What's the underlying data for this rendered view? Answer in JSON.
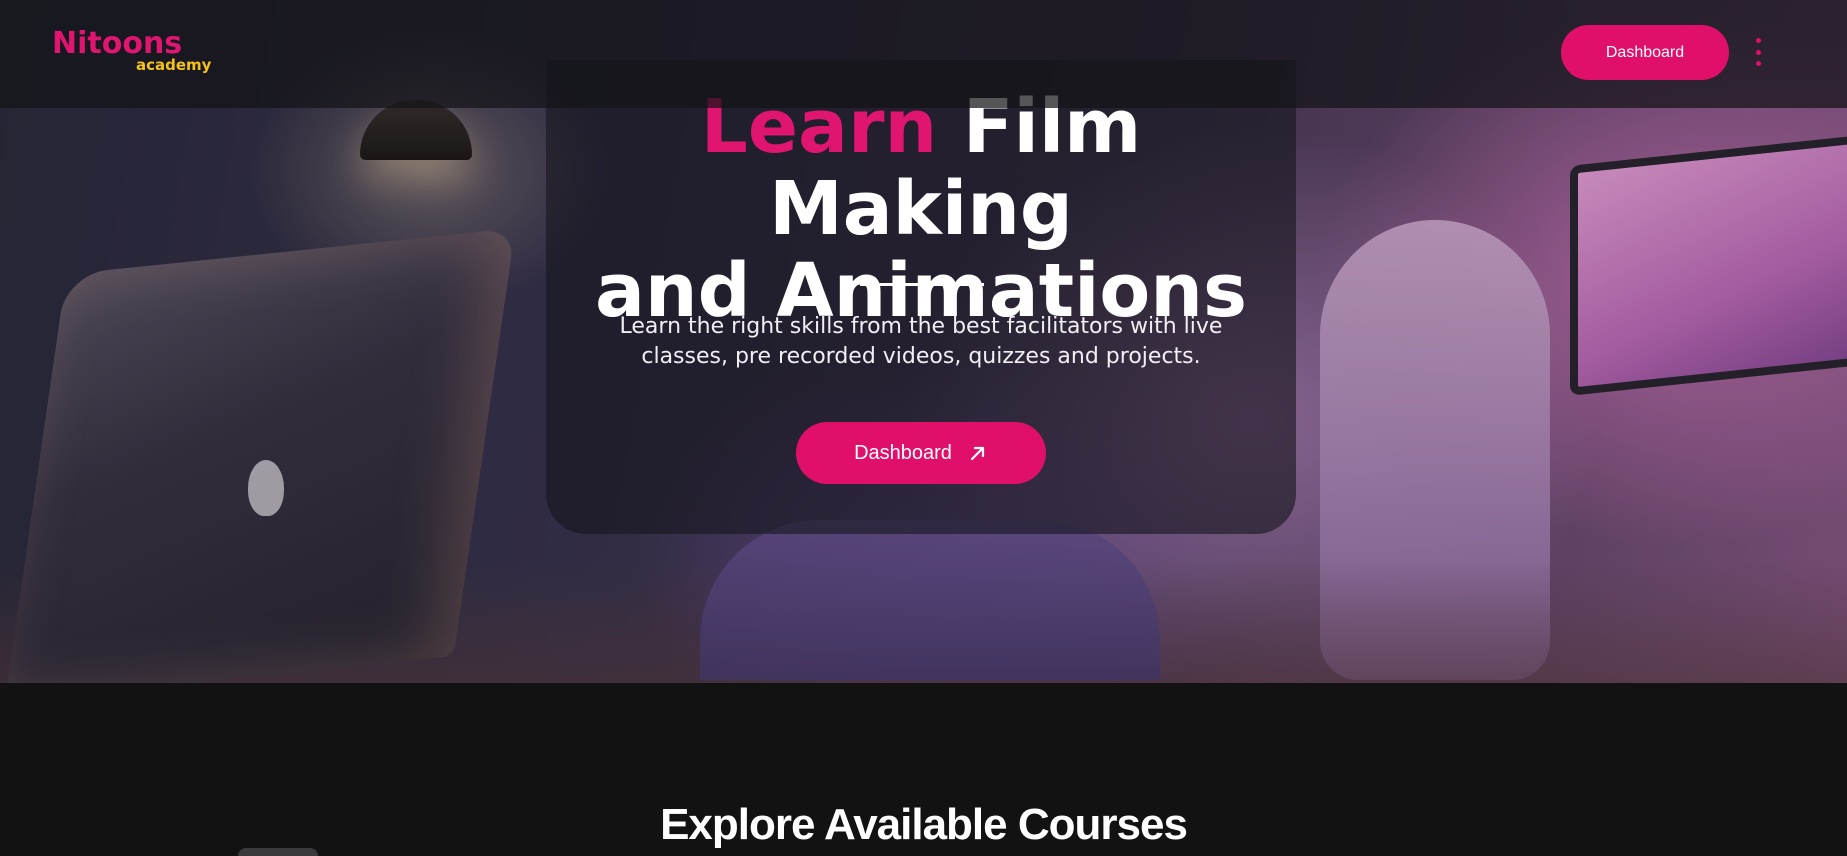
{
  "brand": {
    "logo_main": "Nitoons",
    "logo_sub": "academy",
    "primary_color": "#e0106a",
    "secondary_color": "#f4c21a"
  },
  "nav": {
    "dashboard_label": "Dashboard",
    "menu_icon": "kebab-menu-icon"
  },
  "hero": {
    "title_accent": "Learn",
    "title_rest_line1": " Film Making",
    "title_line2": "and Animations",
    "subtitle": "Learn the right skills from the best facilitators with live classes, pre recorded videos, quizzes and projects.",
    "cta_label": "Dashboard",
    "cta_icon": "arrow-up-right-icon"
  },
  "courses": {
    "section_title": "Explore Available Courses"
  }
}
